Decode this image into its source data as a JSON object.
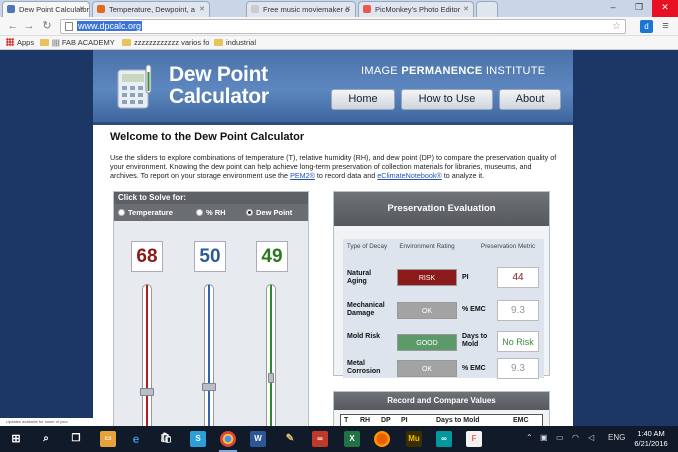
{
  "browser": {
    "tabs": [
      {
        "title": "Dew Point Calculator",
        "favicon_color": "#4a78b8",
        "active": true
      },
      {
        "title": "Temperature, Dewpoint, a",
        "favicon_color": "#e06b1f",
        "active": false
      },
      {
        "title": "Free music moviemaker o",
        "favicon_color": "#cccccc",
        "active": false
      },
      {
        "title": "PicMonkey's Photo Editor",
        "favicon_color": "#e85a50",
        "active": false
      }
    ],
    "url": "www.dpcalc.org",
    "bookmarks": [
      {
        "label": "Apps",
        "icon": "apps-grid-icon"
      },
      {
        "label": "|||| FAB ACADEMY",
        "icon": "folder-icon"
      },
      {
        "label": "zzzzzzzzzzzz varios fo",
        "icon": "folder-icon"
      },
      {
        "label": "industrial",
        "icon": "folder-icon"
      }
    ]
  },
  "site": {
    "logo_line1": "Dew Point",
    "logo_line2": "Calculator",
    "institute_prefix": "IMAGE ",
    "institute_bold": "PERMANENCE",
    "institute_suffix": " INSTITUTE",
    "nav": [
      "Home",
      "How to Use",
      "About"
    ]
  },
  "intro": {
    "heading": "Welcome to the Dew Point Calculator",
    "text_before": "Use the sliders to explore combinations of temperature (T), relative humidity (RH), and dew point (DP) to compare the preservation quality of your environment. Knowing the dew point can help achieve long-term preservation of collection materials for libraries, museums, and archives. To report on your storage environment use the ",
    "link1": "PEM2®",
    "text_middle": " to record data and ",
    "link2": "eClimateNotebook®",
    "text_after": " to analyze it."
  },
  "solver": {
    "heading": "Click to Solve for:",
    "options": [
      "Temperature",
      "% RH",
      "Dew Point"
    ],
    "selected": "Dew Point",
    "temperature": "68",
    "rh": "50",
    "dew_point": "49",
    "temperature_color": "#8b1a1a",
    "rh_color": "#2a5a9a",
    "dew_point_color": "#2b7a1e"
  },
  "evaluation": {
    "heading": "Preservation Evaluation",
    "col_type": "Type of Decay",
    "col_rating": "Environment Rating",
    "col_metric": "Preservation Metric",
    "rows": [
      {
        "label": "Natural Aging",
        "rating": "RISK",
        "rating_color": "#8b1a1a",
        "metric_label": "PI",
        "metric": "44",
        "metric_color": "#8b1a1a"
      },
      {
        "label": "Mechanical Damage",
        "rating": "OK",
        "rating_color": "#a3a3a3",
        "metric_label": "% EMC",
        "metric": "9.3",
        "metric_color": "#999999"
      },
      {
        "label": "Mold Risk",
        "rating": "GOOD",
        "rating_color": "#5c9a6a",
        "metric_label": "Days to Mold",
        "metric": "No Risk",
        "metric_color": "#3d8a3d"
      },
      {
        "label": "Metal Corrosion",
        "rating": "OK",
        "rating_color": "#a3a3a3",
        "metric_label": "% EMC",
        "metric": "9.3",
        "metric_color": "#999999"
      }
    ]
  },
  "record": {
    "heading": "Record and Compare Values",
    "columns": [
      "T",
      "RH",
      "DP",
      "PI",
      "Days to Mold",
      "EMC"
    ]
  },
  "notification": "Updates available for some of your",
  "taskbar": {
    "language": "ENG",
    "time": "1:40 AM",
    "date": "6/21/2016"
  }
}
